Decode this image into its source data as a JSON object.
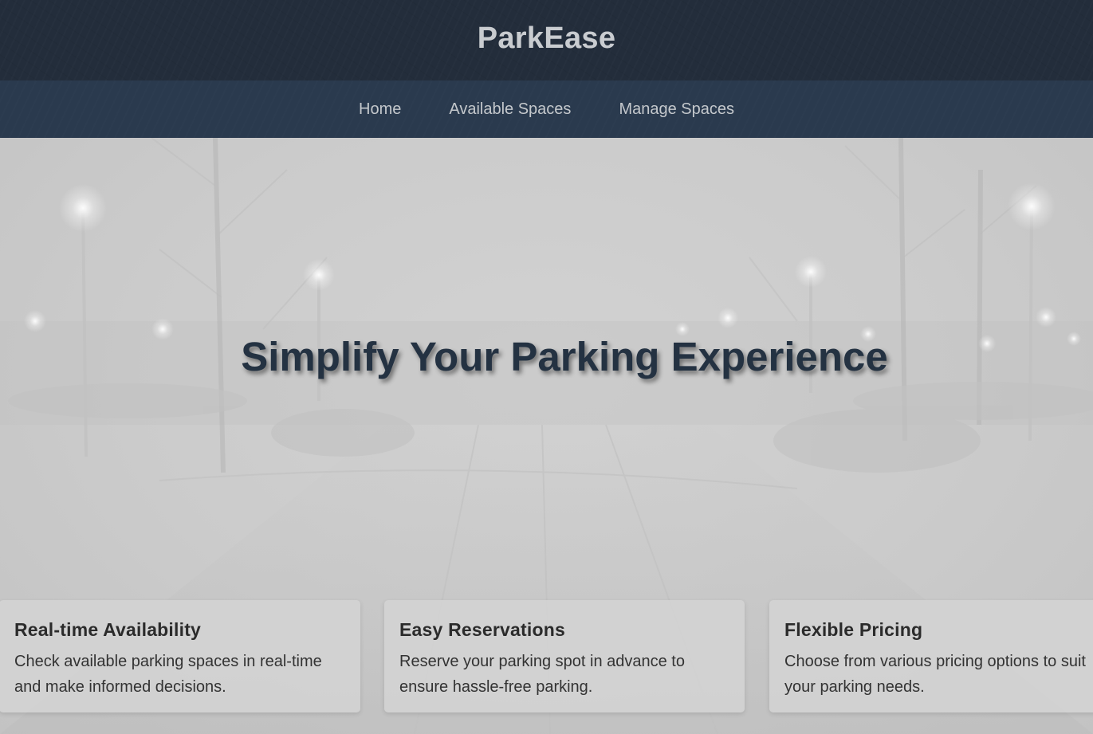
{
  "header": {
    "title": "ParkEase"
  },
  "nav": {
    "items": [
      {
        "label": "Home"
      },
      {
        "label": "Available Spaces"
      },
      {
        "label": "Manage Spaces"
      }
    ]
  },
  "hero": {
    "headline": "Simplify Your Parking Experience"
  },
  "features": [
    {
      "title": "Real-time Availability",
      "text": "Check available parking spaces in real-time and make informed decisions."
    },
    {
      "title": "Easy Reservations",
      "text": "Reserve your parking spot in advance to ensure hassle-free parking."
    },
    {
      "title": "Flexible Pricing",
      "text": "Choose from various pricing options to suit your parking needs."
    }
  ],
  "colors": {
    "header_bg": "#232d3b",
    "nav_bg": "#2a3a4e",
    "headline": "#243242"
  }
}
